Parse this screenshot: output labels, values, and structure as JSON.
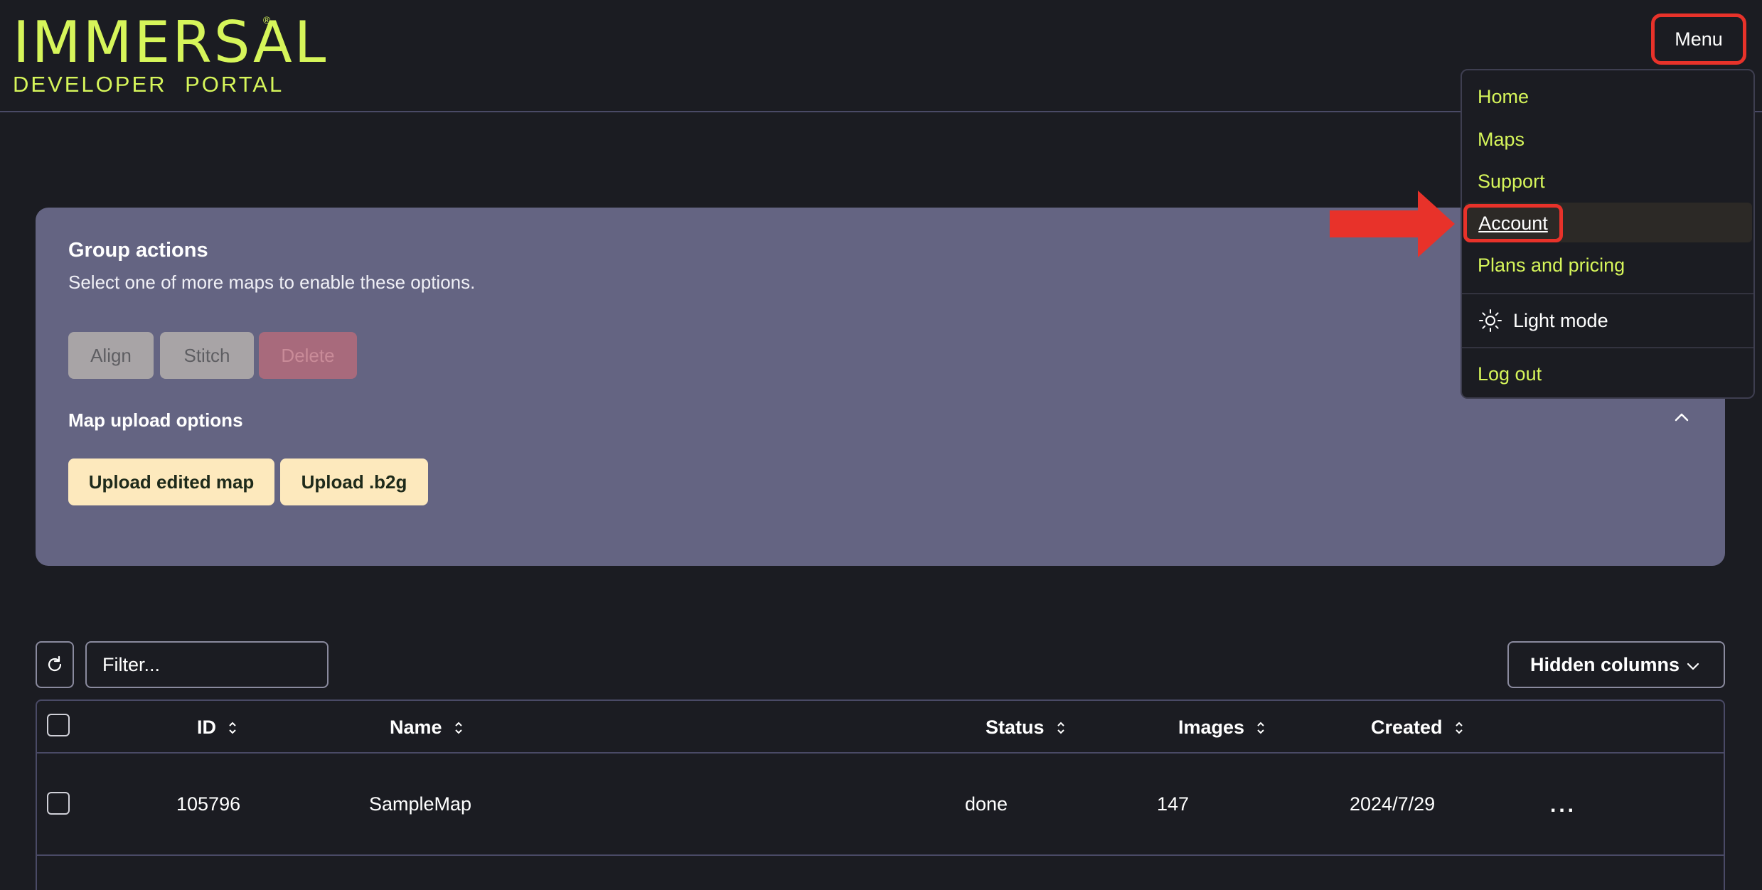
{
  "brand": {
    "logo_main": "IMMERSAL",
    "logo_reg": "®",
    "logo_sub": "DEVELOPER PORTAL"
  },
  "header": {
    "menu_label": "Menu"
  },
  "group_actions": {
    "title": "Group actions",
    "description": "Select one of more maps to enable these options.",
    "buttons": {
      "align": "Align",
      "stitch": "Stitch",
      "delete": "Delete"
    },
    "upload_title": "Map upload options",
    "upload_buttons": {
      "edited": "Upload edited map",
      "b2g": "Upload .b2g"
    }
  },
  "table_controls": {
    "filter_placeholder": "Filter...",
    "hidden_columns_label": "Hidden columns"
  },
  "table": {
    "columns": [
      "ID",
      "Name",
      "Status",
      "Images",
      "Created"
    ],
    "rows": [
      {
        "id": "105796",
        "name": "SampleMap",
        "status": "done",
        "images": "147",
        "created": "2024/7/29",
        "more": "..."
      }
    ]
  },
  "dropdown": {
    "items": {
      "home": "Home",
      "maps": "Maps",
      "support": "Support",
      "account": "Account",
      "plans": "Plans and pricing",
      "light_mode": "Light mode",
      "logout": "Log out"
    }
  },
  "colors": {
    "background": "#1b1c22",
    "accent": "#d6f55a",
    "panel": "#646482",
    "highlight": "#e8322a",
    "upload_button": "#fde9bd"
  }
}
